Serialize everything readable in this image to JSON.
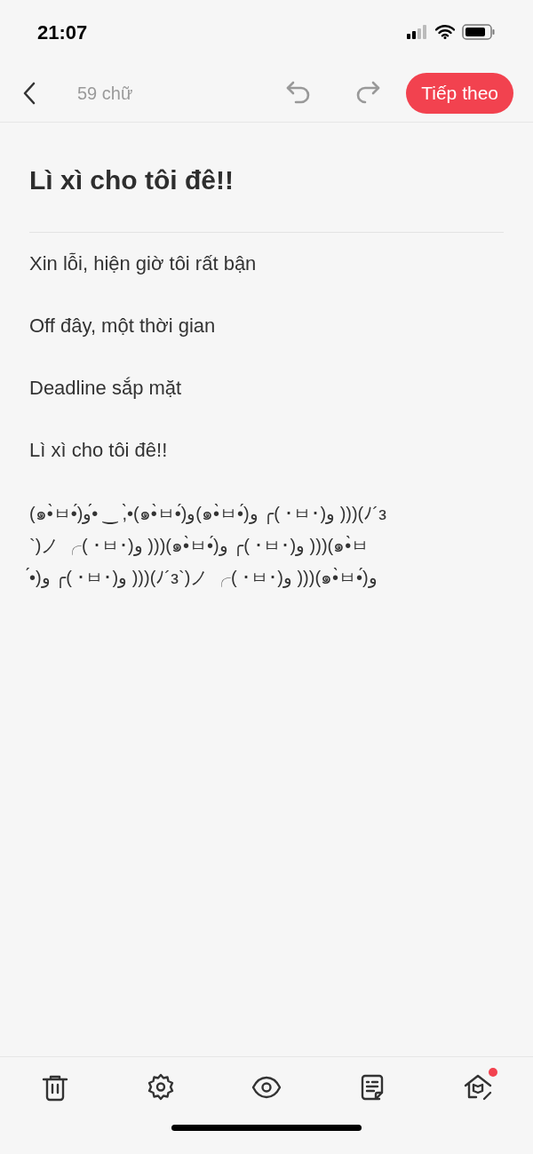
{
  "status_bar": {
    "time": "21:07"
  },
  "toolbar": {
    "word_count": "59 chữ",
    "next_button": "Tiếp theo"
  },
  "document": {
    "title": "Lì xì cho tôi đê!!",
    "paragraphs": [
      "Xin lỗi, hiện giờ tôi rất bận",
      "Off đây, một thời gian",
      "Deadline sắp mặt",
      "Lì xì cho tôi đê!!"
    ],
    "kaomoji_lines": [
      "(๑•̀ㅂ•́)و•́ ‿ ,•̀(๑•̀ㅂ•́)و(๑•̀ㅂ•́)و ╭( ･ㅂ･)و )))(ﾉ´з",
      "`)ノ ╭( ･ㅂ･)و )))(๑•̀ㅂ•́)و ╭( ･ㅂ･)و )))(๑•̀ㅂ",
      "•́)و ╭( ･ㅂ･)و )))(ﾉ´з`)ノ ╭( ･ㅂ･)و )))(๑•̀ㅂ•́)و"
    ]
  },
  "bottom_bar": [
    {
      "kind": "trash",
      "badge": false
    },
    {
      "kind": "settings",
      "badge": false
    },
    {
      "kind": "preview",
      "badge": false
    },
    {
      "kind": "notes",
      "badge": false
    },
    {
      "kind": "home",
      "badge": true
    }
  ]
}
